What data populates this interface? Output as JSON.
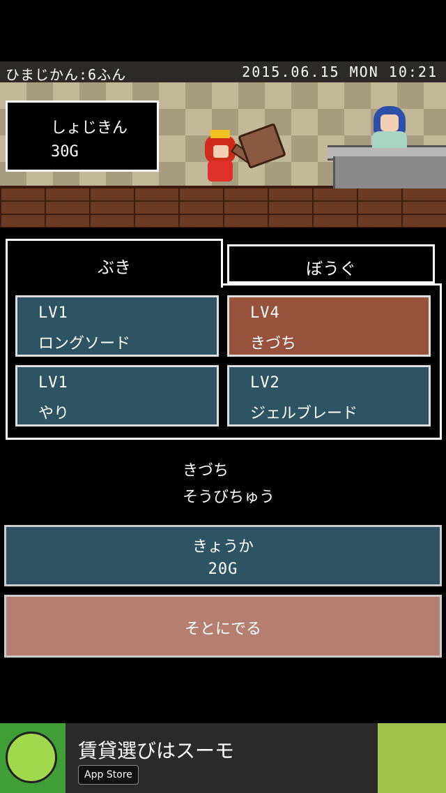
{
  "status": {
    "play_time": "ひまじかん:6ふん",
    "datetime": "2015.06.15 MON 10:21"
  },
  "money": {
    "label": "しょじきん",
    "value": "30G"
  },
  "tabs": [
    {
      "label": "ぶき",
      "active": true
    },
    {
      "label": "ぼうぐ",
      "active": false
    }
  ],
  "items": [
    {
      "level": "LV1",
      "name": "ロングソード",
      "color": "#2e5464"
    },
    {
      "level": "LV4",
      "name": "きづち",
      "color": "#96523a"
    },
    {
      "level": "LV1",
      "name": "やり",
      "color": "#2e5464"
    },
    {
      "level": "LV2",
      "name": "ジェルブレード",
      "color": "#2e5464"
    }
  ],
  "selected": {
    "name": "きづち",
    "status": "そうびちゅう"
  },
  "upgrade": {
    "label": "きょうか",
    "cost": "20G"
  },
  "exit": {
    "label": "そとにでる"
  },
  "ad": {
    "title": "賃貸選びはスーモ",
    "store_badge": "App Store"
  }
}
